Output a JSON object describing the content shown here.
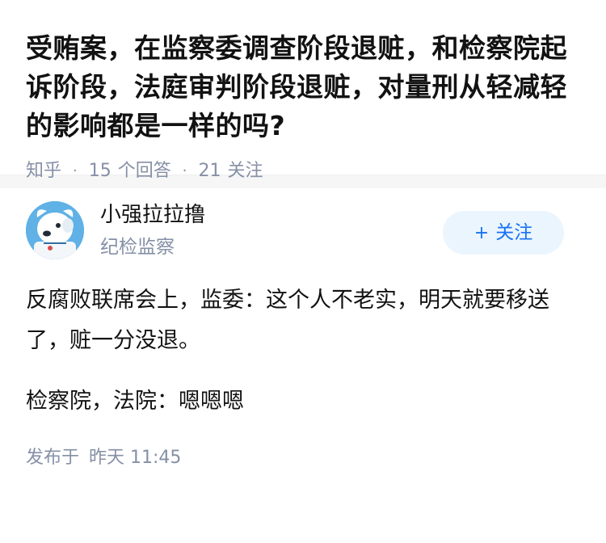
{
  "question": {
    "title": "受贿案，在监察委调查阶段退赃，和检察院起诉阶段，法庭审判阶段退赃，对量刑从轻减轻的影响都是一样的吗?",
    "source": "知乎",
    "answer_count": "15",
    "answer_label": "个回答",
    "follower_count": "21",
    "follower_label": "关注"
  },
  "answer": {
    "author_name": "小强拉拉撸",
    "author_bio": "纪检监察",
    "follow_button": "关注",
    "follow_icon": "plus-icon",
    "paragraphs": [
      "反腐败联席会上，监委：这个人不老实，明天就要移送了，赃一分没退。",
      "检察院，法院：嗯嗯嗯"
    ],
    "publish_label": "发布于",
    "publish_time": "昨天 11:45"
  },
  "colors": {
    "accent": "#1772f6",
    "muted": "#8590a6",
    "avatar_bg": "#5fb1e6"
  }
}
